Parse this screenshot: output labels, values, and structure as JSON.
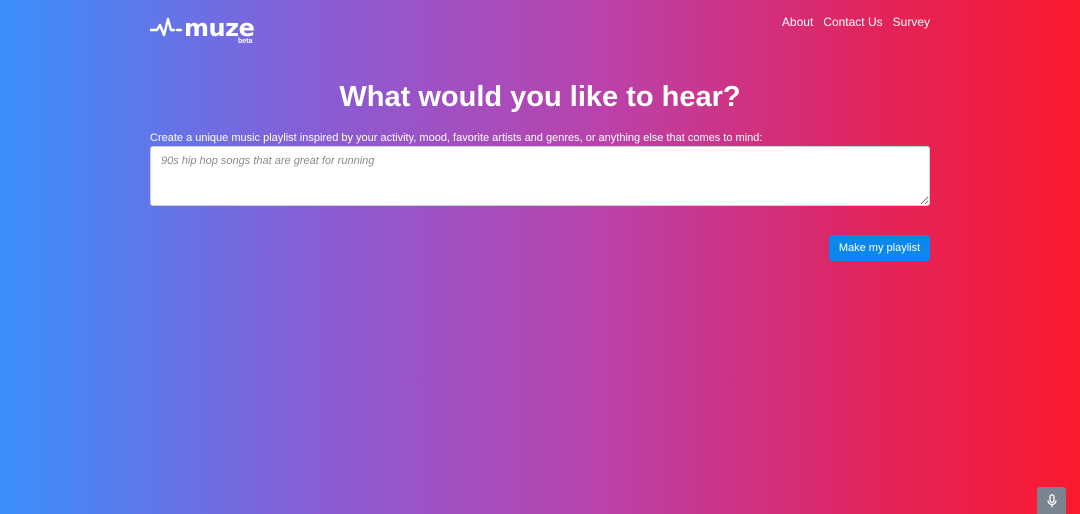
{
  "brand": {
    "name": "muze",
    "tag": "beta"
  },
  "nav": {
    "items": [
      {
        "label": "About"
      },
      {
        "label": "Contact Us"
      },
      {
        "label": "Survey"
      }
    ]
  },
  "main": {
    "heading": "What would you like to hear?",
    "prompt_label": "Create a unique music playlist inspired by your activity, mood, favorite artists and genres, or anything else that comes to mind:",
    "prompt_placeholder": "90s hip hop songs that are great for running",
    "prompt_value": "",
    "submit_label": "Make my playlist"
  },
  "widgets": {
    "mic_icon": "microphone-icon"
  },
  "colors": {
    "gradient_start": "#3a8ffc",
    "gradient_end": "#fb1a2e",
    "button": "#0b87ee",
    "mic_button": "#7a8491"
  }
}
